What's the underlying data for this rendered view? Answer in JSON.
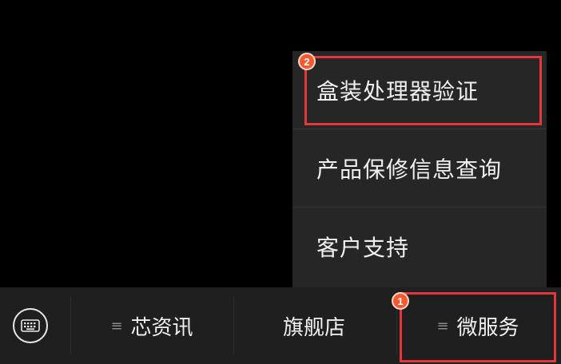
{
  "popup_menu": {
    "items": [
      {
        "label": "盒装处理器验证"
      },
      {
        "label": "产品保修信息查询"
      },
      {
        "label": "客户支持"
      }
    ]
  },
  "bottom_bar": {
    "keyboard_icon": "keyboard-icon",
    "tabs": [
      {
        "label": "芯资讯",
        "icon": "menu-lines-icon"
      },
      {
        "label": "旗舰店"
      },
      {
        "label": "微服务",
        "icon": "menu-lines-icon"
      }
    ]
  },
  "annotations": {
    "step1": "1",
    "step2": "2",
    "highlight_color": "#e5363b",
    "badge_color": "#f4592f"
  }
}
